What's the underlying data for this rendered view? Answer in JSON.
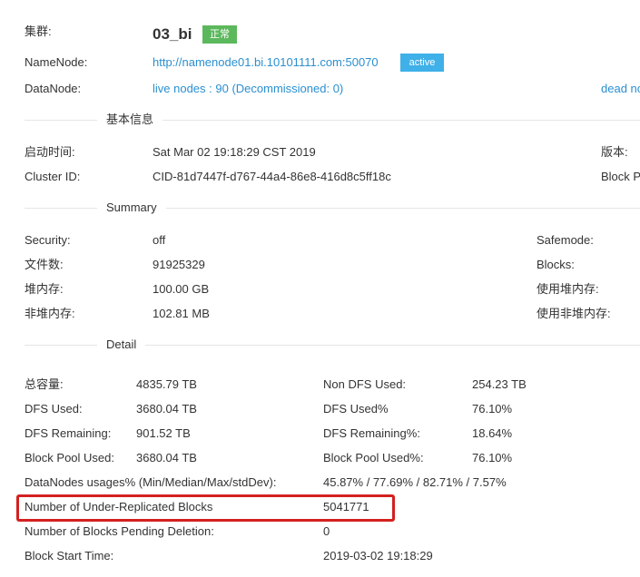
{
  "cluster": {
    "label": "集群:",
    "name": "03_bi",
    "status": "正常",
    "namenode_label": "NameNode:",
    "namenode_url": "http://namenode01.bi.10101111.com:50070",
    "namenode_state": "active",
    "datanode_label": "DataNode:",
    "live_nodes": "live nodes : 90 (Decommissioned: 0)",
    "dead_nodes": "dead no"
  },
  "basic": {
    "title": "基本信息",
    "start_label": "启动时间:",
    "start_value": "Sat Mar 02 19:18:29 CST 2019",
    "version_label": "版本:",
    "clusterid_label": "Cluster ID:",
    "clusterid_value": "CID-81d7447f-d767-44a4-86e8-416d8c5ff18c",
    "blockpool_label": "Block P"
  },
  "summary": {
    "title": "Summary",
    "security_label": "Security:",
    "security_value": "off",
    "files_label": "文件数:",
    "files_value": "91925329",
    "heap_label": "堆内存:",
    "heap_value": "100.00 GB",
    "nonheap_label": "非堆内存:",
    "nonheap_value": "102.81 MB",
    "safemode_label": "Safemode:",
    "blocks_label": "Blocks:",
    "heap_used_label": "使用堆内存:",
    "nonheap_used_label": "使用非堆内存:"
  },
  "detail": {
    "title": "Detail",
    "capacity_label": "总容量:",
    "capacity_value": "4835.79 TB",
    "nondfs_label": "Non DFS Used:",
    "nondfs_value": "254.23 TB",
    "dfsused_label": "DFS Used:",
    "dfsused_value": "3680.04 TB",
    "dfsusedpct_label": "DFS Used%",
    "dfsusedpct_value": "76.10%",
    "dfsrem_label": "DFS Remaining:",
    "dfsrem_value": "901.52 TB",
    "dfsrempct_label": "DFS Remaining%:",
    "dfsrempct_value": "18.64%",
    "bpused_label": "Block Pool Used:",
    "bpused_value": "3680.04 TB",
    "bpusedpct_label": "Block Pool Used%:",
    "bpusedpct_value": "76.10%",
    "dnusage_label": "DataNodes usages% (Min/Median/Max/stdDev):",
    "dnusage_value": "45.87% / 77.69% / 82.71% / 7.57%",
    "underrep_label": "Number of Under-Replicated Blocks",
    "underrep_value": "5041771",
    "pending_label": "Number of Blocks Pending Deletion:",
    "pending_value": "0",
    "blockstart_label": "Block Start Time:",
    "blockstart_value": "2019-03-02 19:18:29"
  },
  "colors": {
    "link": "#2a8fd0",
    "status_green": "#5cb85c",
    "active_blue": "#3fb0e8",
    "highlight_red": "#d42020"
  }
}
